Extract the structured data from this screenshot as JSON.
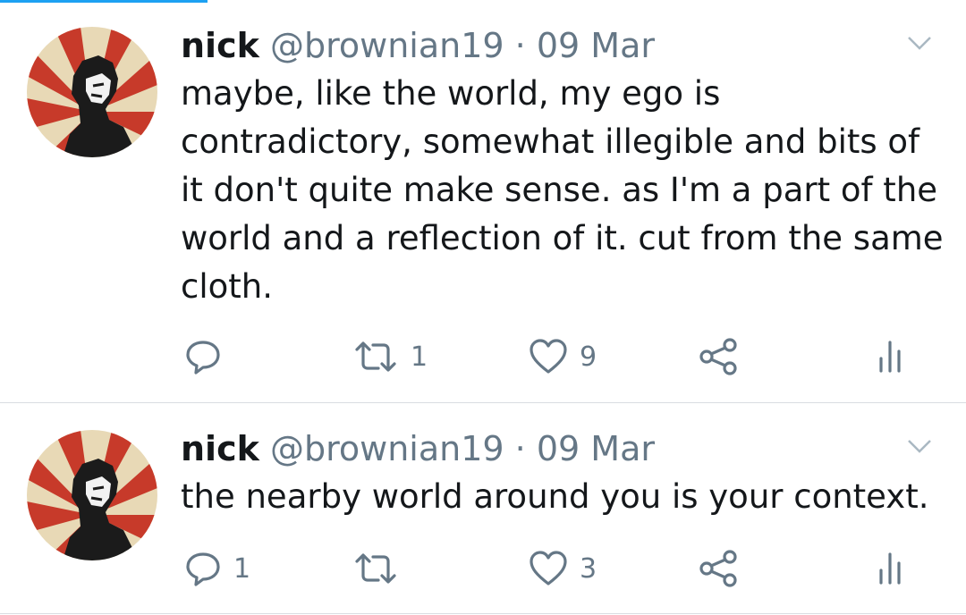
{
  "colors": {
    "accent": "#1da1f2",
    "text": "#14171a",
    "secondary": "#657786",
    "separator": "#d9dde1"
  },
  "tweets": [
    {
      "name": "nick",
      "handle": "@brownian19",
      "dot": "·",
      "date": "09 Mar",
      "text": "maybe, like the world, my ego is contradictory, somewhat illegible and bits of it don't quite make sense. as I'm a part of the world and a reflection of it. cut from the same cloth.",
      "reply_count": "",
      "retweet_count": "1",
      "like_count": "9",
      "icons": [
        "reply-icon",
        "retweet-icon",
        "like-icon",
        "share-icon",
        "analytics-icon",
        "chevron-down-icon"
      ]
    },
    {
      "name": "nick",
      "handle": "@brownian19",
      "dot": "·",
      "date": "09 Mar",
      "text": "the nearby world around you is your context.",
      "reply_count": "1",
      "retweet_count": "",
      "like_count": "3",
      "icons": [
        "reply-icon",
        "retweet-icon",
        "like-icon",
        "share-icon",
        "analytics-icon",
        "chevron-down-icon"
      ]
    }
  ]
}
